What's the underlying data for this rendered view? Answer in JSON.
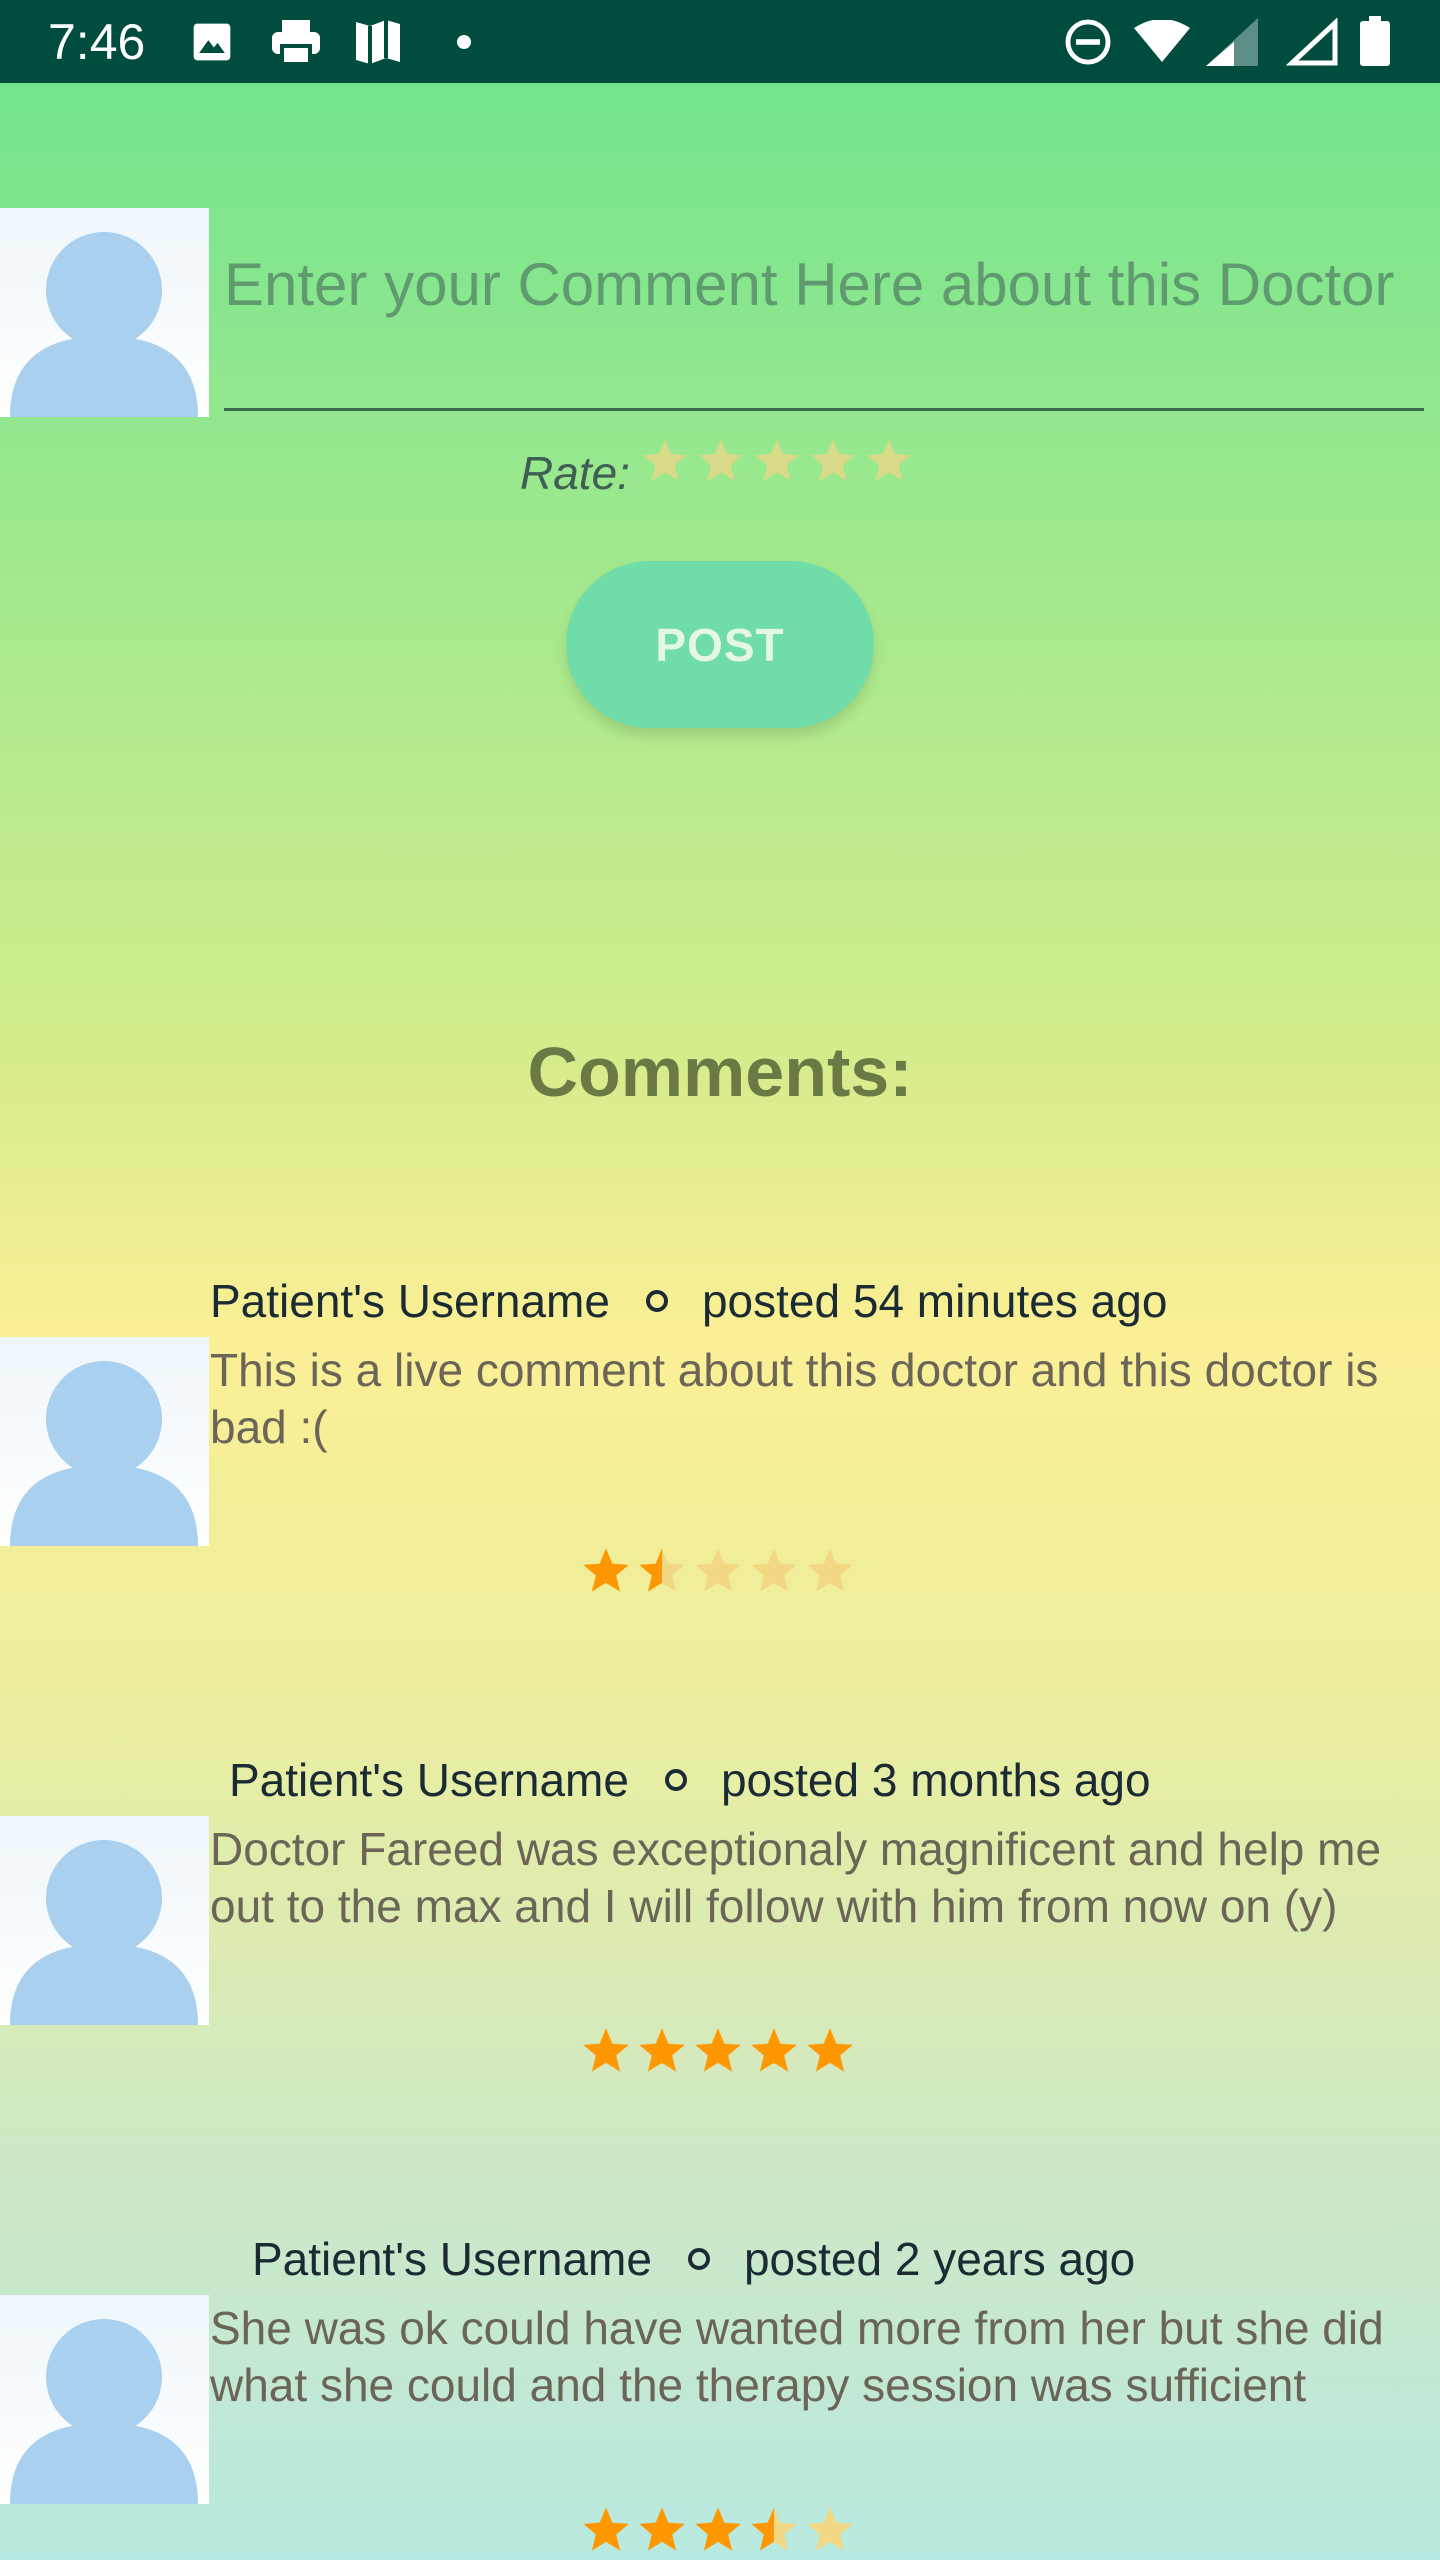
{
  "status_bar": {
    "time": "7:46",
    "left_icons": [
      "image-icon",
      "print-icon",
      "maps-icon",
      "notification-dot-icon"
    ],
    "right_icons": [
      "do-not-disturb-icon",
      "wifi-icon",
      "signal-icon",
      "signal-empty-icon",
      "battery-icon"
    ]
  },
  "compose": {
    "placeholder": "Enter your Comment Here about this Doctor",
    "rate_label": "Rate:",
    "rating": 0,
    "post_label": "POST"
  },
  "comments_heading": "Comments:",
  "comments": [
    {
      "username": "Patient's Username",
      "posted": "posted 54 minutes ago",
      "text": "This is a live comment about this doctor and this doctor is bad :(",
      "rating": 1.5
    },
    {
      "username": "Patient's Username",
      "posted": "posted 3 months ago",
      "text": "Doctor Fareed was exceptionaly magnificent and help me out to the max and I will follow with him from now on (y)",
      "rating": 5
    },
    {
      "username": "Patient's Username",
      "posted": "posted 2 years ago",
      "text": "She was ok could have wanted more from her but she did what she could and the therapy session was sufficient",
      "rating": 3.5
    }
  ],
  "colors": {
    "status_bar": "#004d40",
    "star_filled": "#ff9800",
    "star_empty": "#f2d884",
    "star_empty_input": "#d9d98a",
    "post_button": "#6fdcaa"
  }
}
